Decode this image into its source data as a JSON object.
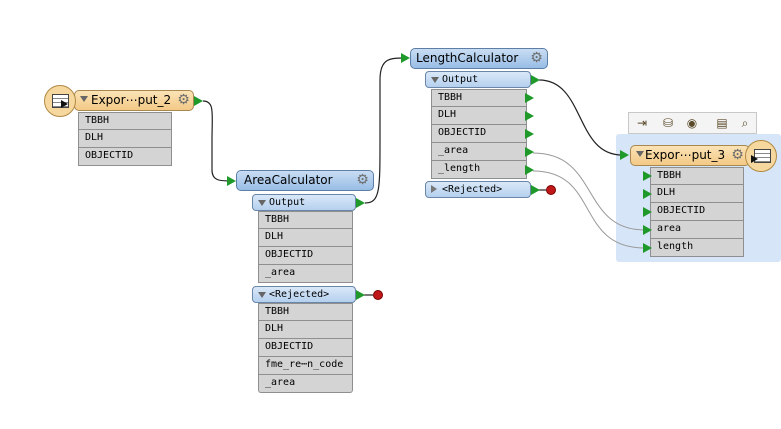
{
  "reader": {
    "title": "Expor⋯put_2",
    "attributes": [
      "TBBH",
      "DLH",
      "OBJECTID"
    ]
  },
  "area_calculator": {
    "title": "AreaCalculator",
    "output_label": "Output",
    "output_attributes": [
      "TBBH",
      "DLH",
      "OBJECTID",
      "_area"
    ],
    "rejected_label": "<Rejected>",
    "rejected_attributes": [
      "TBBH",
      "DLH",
      "OBJECTID",
      "fme_re⋯n_code",
      "_area"
    ]
  },
  "length_calculator": {
    "title": "LengthCalculator",
    "output_label": "Output",
    "output_attributes": [
      "TBBH",
      "DLH",
      "OBJECTID",
      "_area",
      "_length"
    ],
    "rejected_label": "<Rejected>"
  },
  "writer": {
    "title": "Expor⋯put_3",
    "attributes": [
      "TBBH",
      "DLH",
      "OBJECTID",
      "area",
      "length"
    ]
  },
  "toolbar_icons": [
    "inspect-icon",
    "cache-icon",
    "run-to-this-icon",
    "open-folder-icon",
    "search-icon"
  ],
  "icons": {
    "gear": "⚙",
    "toolbar_glyphs": [
      "⇥",
      "⛁",
      "◉",
      "▤",
      "⌕"
    ]
  },
  "colors": {
    "reader_header": "#f3c986",
    "transformer_header": "#98bde6",
    "port_arrow": "#1f9a2a",
    "rejected_dot": "#c01818",
    "selection": "#d6e6f8"
  }
}
